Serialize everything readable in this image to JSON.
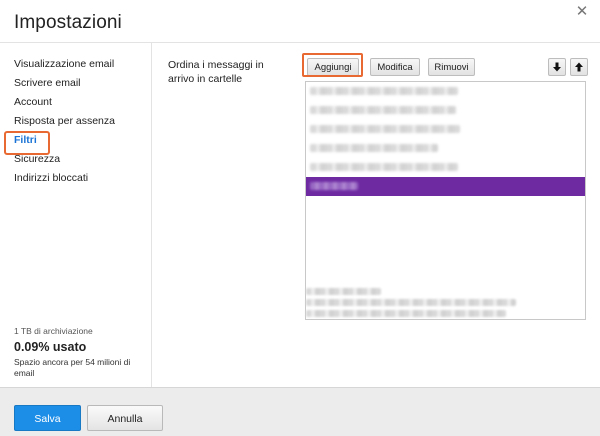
{
  "dialog": {
    "title": "Impostazioni",
    "close_icon": "close-icon"
  },
  "sidebar": {
    "items": [
      {
        "label": "Visualizzazione email",
        "active": false
      },
      {
        "label": "Scrivere email",
        "active": false
      },
      {
        "label": "Account",
        "active": false
      },
      {
        "label": "Risposta per assenza",
        "active": false
      },
      {
        "label": "Filtri",
        "active": true
      },
      {
        "label": "Sicurezza",
        "active": false
      },
      {
        "label": "Indirizzi bloccati",
        "active": false
      }
    ],
    "storage": {
      "capacity": "1 TB di archiviazione",
      "used": "0.09% usato",
      "remaining": "Spazio ancora per 54 milioni di email"
    }
  },
  "filters": {
    "description": "Ordina i messaggi in arrivo in cartelle",
    "add_label": "Aggiungi",
    "edit_label": "Modifica",
    "remove_label": "Rimuovi",
    "move_down_icon": "arrow-down-icon",
    "move_up_icon": "arrow-up-icon",
    "selected_index": 5,
    "row_count": 6
  },
  "footer": {
    "save_label": "Salva",
    "cancel_label": "Annulla"
  },
  "colors": {
    "accent": "#1d8ee8",
    "active_nav": "#1a73d6",
    "highlight_ring": "#e86a32",
    "selected_row": "#6e2aa1"
  }
}
